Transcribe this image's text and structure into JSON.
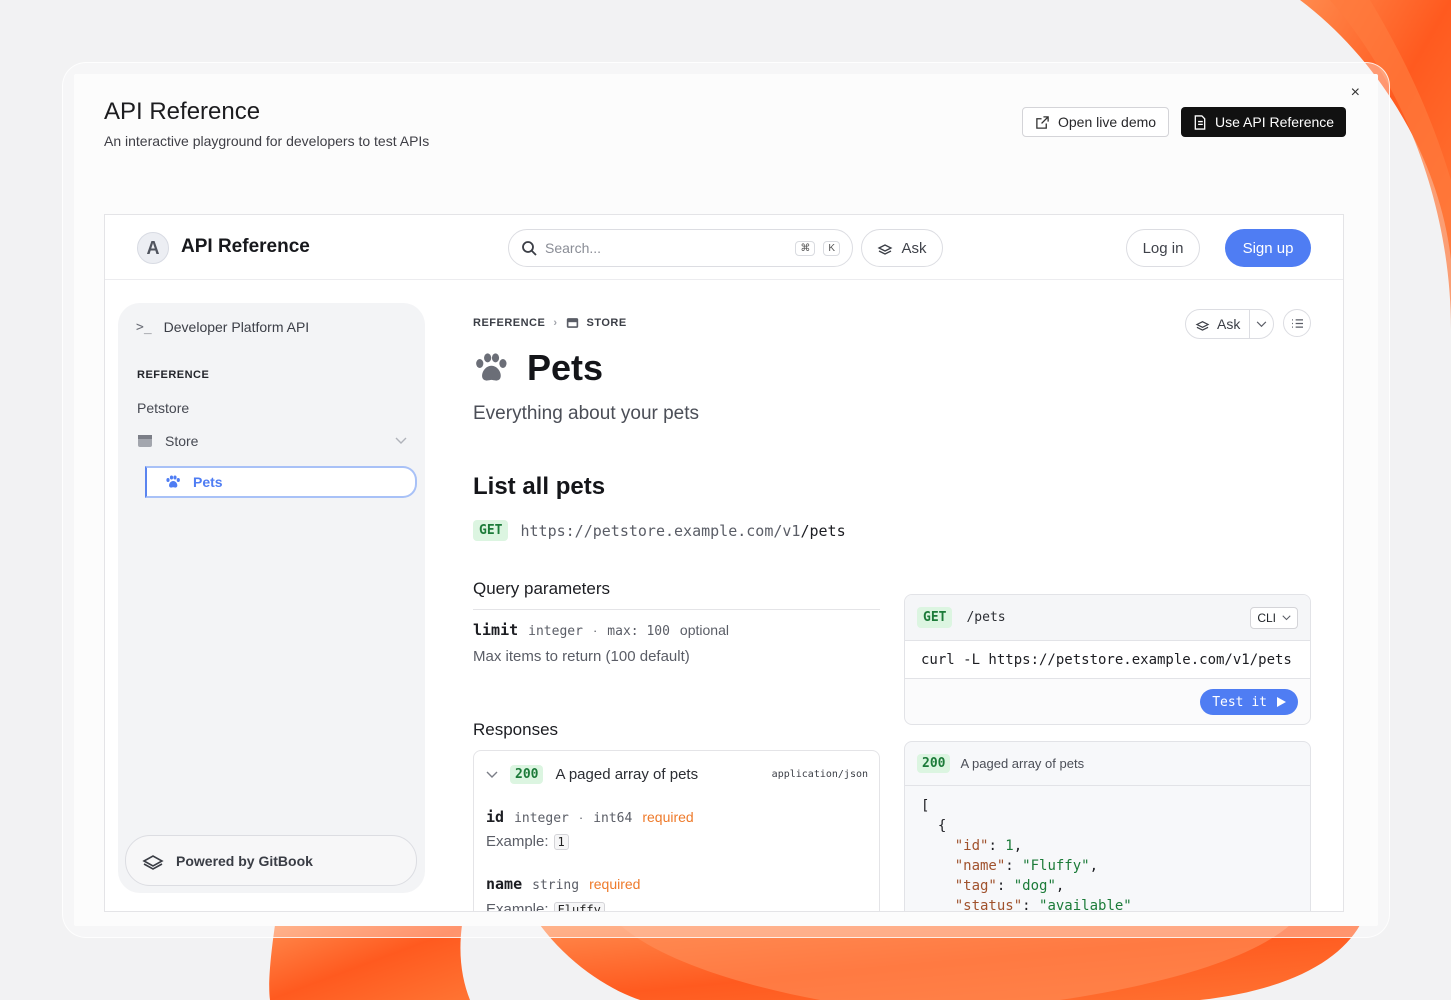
{
  "dialog": {
    "title": "API Reference",
    "subtitle": "An interactive playground for developers to test APIs",
    "close_label": "×",
    "open_demo_label": "Open live demo",
    "use_api_label": "Use API Reference"
  },
  "site": {
    "logo_letter": "A",
    "name": "API Reference",
    "search_placeholder": "Search...",
    "shortcut_cmd": "⌘",
    "shortcut_key": "K",
    "ask_label": "Ask",
    "login_label": "Log in",
    "signup_label": "Sign up"
  },
  "sidebar": {
    "header": "Developer Platform API",
    "section": "REFERENCE",
    "items": [
      {
        "label": "Petstore"
      },
      {
        "label": "Store"
      },
      {
        "label": "Pets"
      }
    ],
    "powered_by": "Powered by GitBook"
  },
  "page": {
    "breadcrumb": [
      "REFERENCE",
      "STORE"
    ],
    "ask_label": "Ask",
    "title": "Pets",
    "description": "Everything about your pets",
    "endpoint_title": "List all pets",
    "method": "GET",
    "url_base": "https://petstore.example.com/v1",
    "url_path": "/pets",
    "query_heading": "Query parameters",
    "params": [
      {
        "name": "limit",
        "type": "integer",
        "constraint_label": "max:",
        "constraint_value": "100",
        "optional": "optional",
        "description": "Max items to return (100 default)"
      }
    ],
    "responses_heading": "Responses",
    "response": {
      "code": "200",
      "description": "A paged array of pets",
      "content_type": "application/json",
      "fields": [
        {
          "name": "id",
          "type": "integer",
          "format": "int64",
          "required": "required",
          "example_label": "Example:",
          "example": "1"
        },
        {
          "name": "name",
          "type": "string",
          "required": "required",
          "example_label": "Example:",
          "example": "Fluffy"
        }
      ]
    }
  },
  "request_panel": {
    "method": "GET",
    "path": "/pets",
    "lang": "CLI",
    "command": "curl -L https://petstore.example.com/v1/pets",
    "test_label": "Test it"
  },
  "response_panel": {
    "code": "200",
    "description": "A paged array of pets",
    "json_open": "[",
    "obj_open": "{",
    "pairs": [
      {
        "key": "\"id\"",
        "value": "1"
      },
      {
        "key": "\"name\"",
        "value": "\"Fluffy\""
      },
      {
        "key": "\"tag\"",
        "value": "\"dog\""
      },
      {
        "key": "\"status\"",
        "value": "\"available\""
      }
    ]
  },
  "colors": {
    "accent": "#4f7df3",
    "get_badge_bg": "#dcf5e1",
    "get_badge_text": "#1c7b39",
    "required": "#ee7a2b",
    "decor_orange": "#ff5a1f"
  }
}
